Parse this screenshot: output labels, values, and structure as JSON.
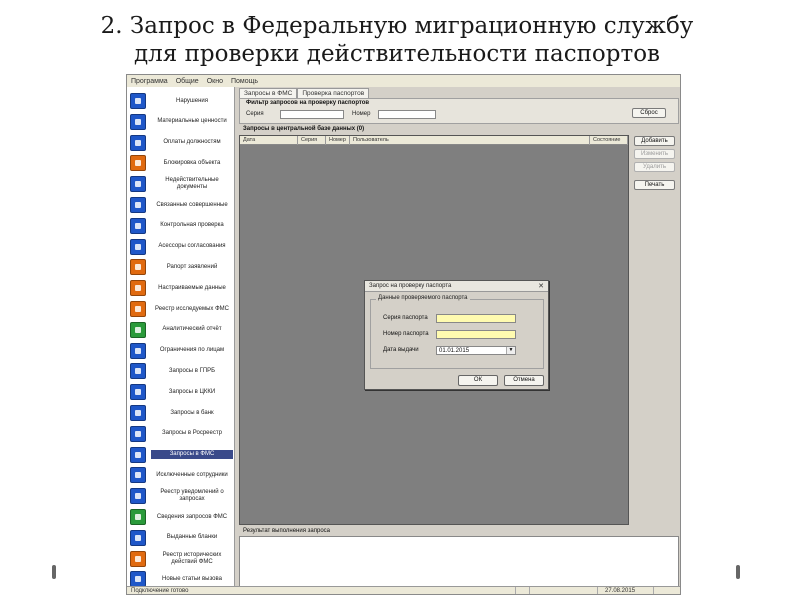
{
  "slide": {
    "title_line1": "2. Запрос в Федеральную миграционную службу",
    "title_line2": "для проверки действительности паспортов"
  },
  "menu": [
    "Программа",
    "Общие",
    "Окно",
    "Помощь"
  ],
  "sidebar": {
    "items": [
      {
        "label": "Нарушения",
        "icon_color": "#1f57c8"
      },
      {
        "label": "Материальные ценности",
        "icon_color": "#1f57c8"
      },
      {
        "label": "Оплаты должностям",
        "icon_color": "#1f57c8"
      },
      {
        "label": "Блокировка объекта",
        "icon_color": "#e06a10"
      },
      {
        "label": "Недействительные документы",
        "icon_color": "#1f57c8"
      },
      {
        "label": "Связанные совершенные",
        "icon_color": "#1f57c8"
      },
      {
        "label": "Контрольная проверка",
        "icon_color": "#1f57c8"
      },
      {
        "label": "Асессоры согласования",
        "icon_color": "#1f57c8"
      },
      {
        "label": "Рапорт заявлений",
        "icon_color": "#e06a10"
      },
      {
        "label": "Настраиваемые данные",
        "icon_color": "#e06a10"
      },
      {
        "label": "Реестр исследуемых ФМС",
        "icon_color": "#e06a10"
      },
      {
        "label": "Аналитический отчёт",
        "icon_color": "#2a9a3a"
      },
      {
        "label": "Ограничения по лицам",
        "icon_color": "#1f57c8"
      },
      {
        "label": "Запросы в ГПРБ",
        "icon_color": "#1f57c8"
      },
      {
        "label": "Запросы в ЦККИ",
        "icon_color": "#1f57c8"
      },
      {
        "label": "Запросы в банк",
        "icon_color": "#1f57c8"
      },
      {
        "label": "Запросы в Росреестр",
        "icon_color": "#1f57c8"
      },
      {
        "label": "Запросы в ФМС",
        "icon_color": "#1f57c8",
        "selected": true
      },
      {
        "label": "Исключенные сотрудники",
        "icon_color": "#1f57c8"
      },
      {
        "label": "Реестр уведомлений о запросах",
        "icon_color": "#1f57c8"
      },
      {
        "label": "Сведения запросов ФМС",
        "icon_color": "#2a9a3a"
      },
      {
        "label": "Выданные бланки",
        "icon_color": "#1f57c8"
      },
      {
        "label": "Реестр исторических действий ФМС",
        "icon_color": "#e06a10"
      },
      {
        "label": "Новые статьи вызова",
        "icon_color": "#1f57c8"
      }
    ]
  },
  "tabs": [
    {
      "label": "Запросы в ФМС"
    },
    {
      "label": "Проверка паспортов"
    }
  ],
  "filter": {
    "title": "Фильтр запросов на проверку паспортов",
    "series_label": "Серия",
    "number_label": "Номер",
    "reset_button": "Сброс"
  },
  "queries": {
    "title": "Запросы в центральной базе данных (0)",
    "columns": [
      "Дата",
      "Серия",
      "Номер",
      "Пользователь",
      "Состояние"
    ]
  },
  "actions": {
    "add": "Добавить",
    "edit": "Изменить",
    "delete": "Удалить",
    "print": "Печать"
  },
  "results": {
    "title": "Результат выполнения запроса"
  },
  "status": {
    "left": "Подключение готово",
    "date": "27.08.2015"
  },
  "dialog": {
    "title": "Запрос на проверку паспорта",
    "group_title": "Данные проверяемого паспорта",
    "series_label": "Серия паспорта",
    "number_label": "Номер паспорта",
    "date_label": "Дата выдачи",
    "date_value": "01.01.2015",
    "ok_button": "ОК",
    "cancel_button": "Отмена"
  }
}
